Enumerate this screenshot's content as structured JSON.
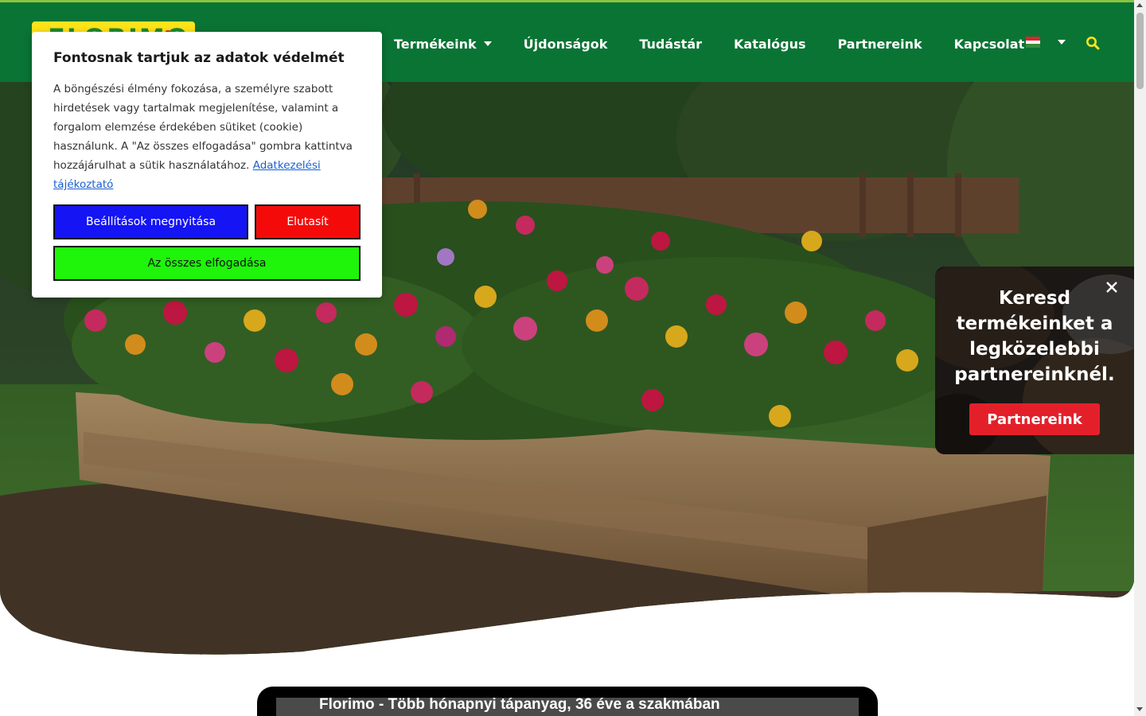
{
  "brand": {
    "logo_text": "FLORIMO",
    "logo_bg": "#ffe31a",
    "logo_fg": "#1f8a2e"
  },
  "colors": {
    "header_bg": "#0a7434",
    "accent_line": "#8cc43c",
    "search_icon": "#ffe31a"
  },
  "nav": {
    "items": [
      {
        "label": "Termékeink",
        "has_dropdown": true
      },
      {
        "label": "Újdonságok",
        "has_dropdown": false
      },
      {
        "label": "Tudástár",
        "has_dropdown": false
      },
      {
        "label": "Katalógus",
        "has_dropdown": false
      },
      {
        "label": "Partnereink",
        "has_dropdown": false
      },
      {
        "label": "Kapcsolat",
        "has_dropdown": false
      }
    ],
    "language_flag": "hungarian-flag-icon",
    "search_icon": "search-icon"
  },
  "cookie": {
    "title": "Fontosnak tartjuk az adatok védelmét",
    "body": "A böngészési élmény fokozása, a személyre szabott hirdetések vagy tartalmak megjelenítése, valamint a forgalom elemzése érdekében sütiket (cookie) használunk. A \"Az összes elfogadása\" gombra kattintva hozzájárulhat a sütik használatához.",
    "link": "Adatkezelési tájékoztató",
    "buttons": {
      "settings": "Beállítások megnyitása",
      "reject": "Elutasít",
      "accept": "Az összes elfogadása"
    },
    "button_colors": {
      "settings": "#1414f5",
      "reject": "#f50a0a",
      "accept": "#1ef50a"
    }
  },
  "partner_card": {
    "text": "Keresd termékeinket a legközelebbi partnereinknél.",
    "button": "Partnereink",
    "button_color": "#e3202a"
  },
  "video": {
    "title": "Florimo - Több hónapnyi tápanyag, 36 éve a szakmában"
  }
}
